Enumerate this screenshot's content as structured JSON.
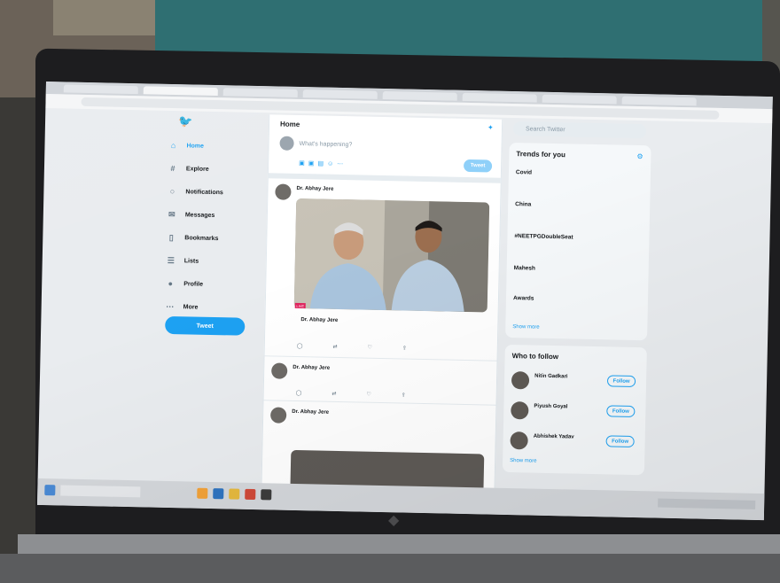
{
  "sidebar": {
    "items": [
      {
        "label": "Home",
        "icon": "home-icon"
      },
      {
        "label": "Explore",
        "icon": "hash-icon"
      },
      {
        "label": "Notifications",
        "icon": "bell-icon"
      },
      {
        "label": "Messages",
        "icon": "mail-icon"
      },
      {
        "label": "Bookmarks",
        "icon": "bookmark-icon"
      },
      {
        "label": "Lists",
        "icon": "list-icon"
      },
      {
        "label": "Profile",
        "icon": "person-icon"
      },
      {
        "label": "More",
        "icon": "more-icon"
      }
    ],
    "tweet_button": "Tweet"
  },
  "main": {
    "title": "Home",
    "compose_placeholder": "What's happening?",
    "compose_button": "Tweet",
    "tweets": [
      {
        "author": "Dr. Abhay Jere",
        "badge": "LIVE",
        "quote_author": "Dr. Abhay Jere"
      },
      {
        "author": "Dr. Abhay Jere"
      },
      {
        "author": "Dr. Abhay Jere"
      }
    ]
  },
  "right": {
    "search_placeholder": "Search Twitter",
    "trends_title": "Trends for you",
    "trends": [
      {
        "name": "Covid"
      },
      {
        "name": "China"
      },
      {
        "name": "#NEETPGDoubleSeat"
      },
      {
        "name": "Mahesh"
      },
      {
        "name": "Awards"
      }
    ],
    "show_more": "Show more",
    "who_to_follow_title": "Who to follow",
    "follow_suggestions": [
      {
        "name": "Nitin Gadkari"
      },
      {
        "name": "Piyush Goyal"
      },
      {
        "name": "Abhishek Yadav"
      }
    ],
    "follow_button": "Follow",
    "show_more_follow": "Show more"
  },
  "colors": {
    "accent": "#1da1f2",
    "text": "#14171a",
    "muted": "#657786",
    "bezel": "#1d1d1f"
  }
}
